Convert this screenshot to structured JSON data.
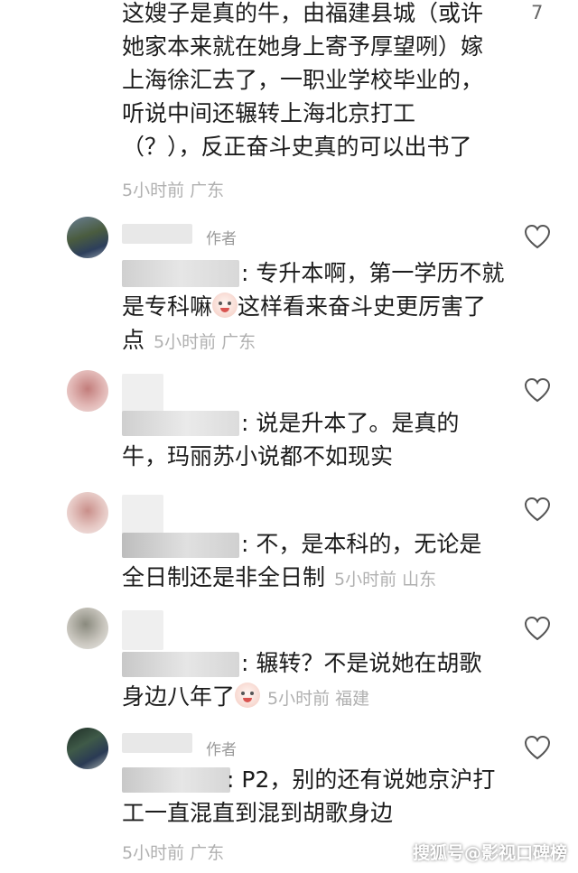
{
  "comment0": {
    "lines": [
      "这嫂子是真的牛，由福建县城（或许",
      "她家本来就在她身上寄予厚望咧）嫁",
      "上海徐汇去了，一职业学校毕业的，",
      "听说中间还辗转上海北京打工",
      "（？），反正奋斗史真的可以出书了"
    ],
    "meta": "5小时前 广东",
    "like_count": "7"
  },
  "comment1": {
    "author_badge": "作者",
    "line1": ": 专升本啊，第一学历不就",
    "line2a": "是专科嘛",
    "line2b": "这样看来奋斗史更厉害了",
    "line3": "点",
    "meta": "5小时前 广东"
  },
  "comment2": {
    "line1": ": 说是升本了。是真的",
    "line2": "牛，玛丽苏小说都不如现实"
  },
  "comment3": {
    "line1": ": 不，是本科的，无论是",
    "line2": "全日制还是非全日制",
    "meta": "5小时前 山东"
  },
  "comment4": {
    "line1": ": 辗转？不是说她在胡歌",
    "line2": "身边八年了",
    "meta": "5小时前 福建"
  },
  "comment5": {
    "author_badge": "作者",
    "line1": ": P2，别的还有说她京沪打",
    "line2": "工一直混直到混到胡歌身边",
    "meta": "5小时前 广东"
  },
  "watermark": "搜狐号@影视口碑榜",
  "icons": {
    "like": "heart-outline-icon",
    "emoji": "crying-face-emoji-icon"
  },
  "colors": {
    "text": "#1c1c1c",
    "meta": "#b0b0b0",
    "badge": "#9a9a9a",
    "heart_stroke": "#555555"
  }
}
